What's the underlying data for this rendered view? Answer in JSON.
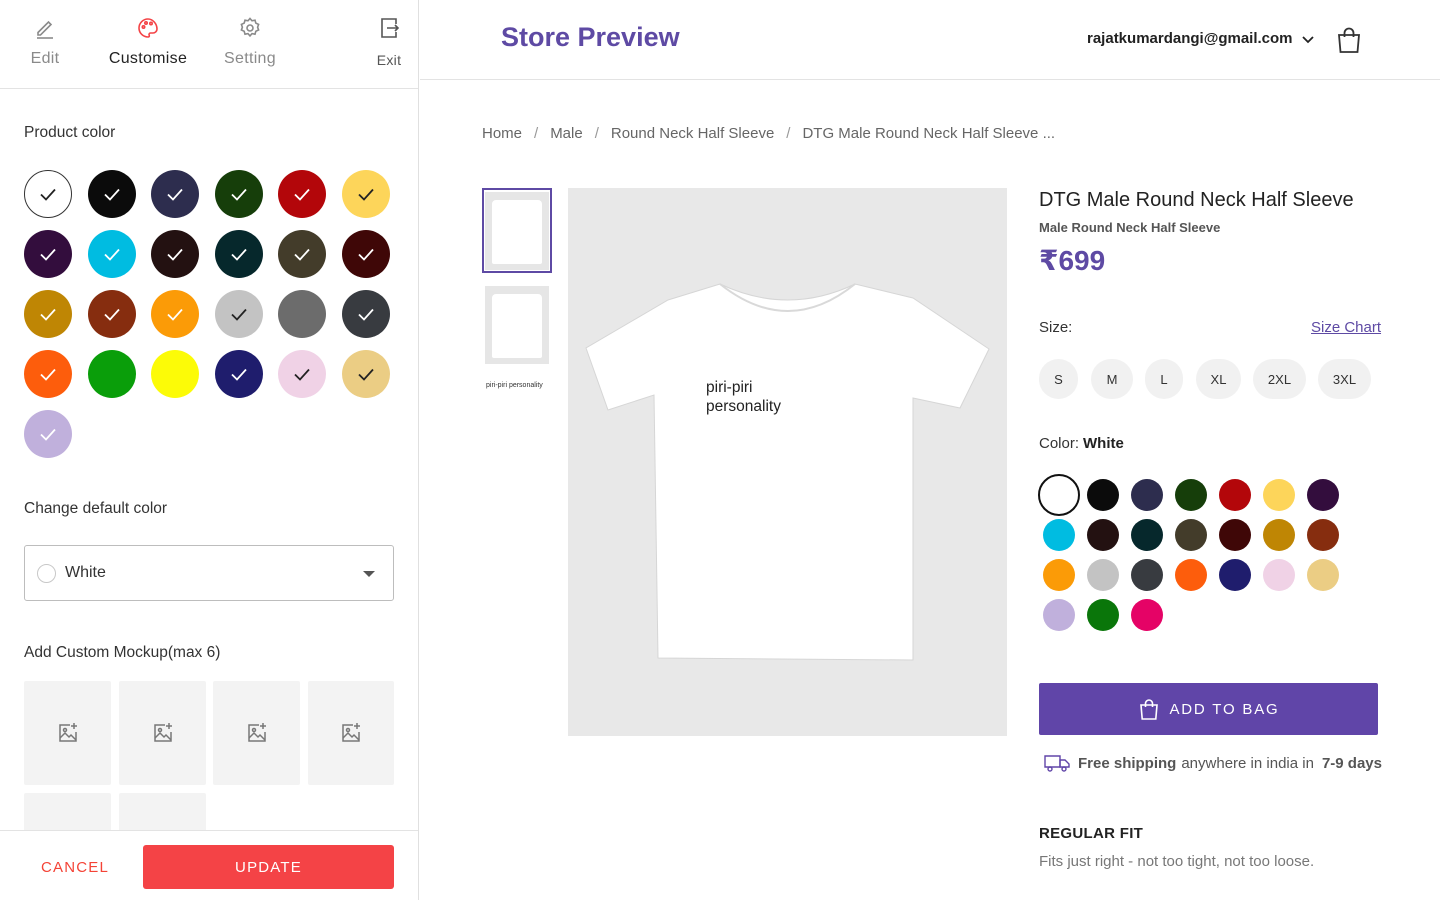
{
  "nav": {
    "edit": "Edit",
    "customise": "Customise",
    "setting": "Setting",
    "exit": "Exit"
  },
  "left": {
    "product_color_title": "Product color",
    "product_colors": [
      {
        "hex": "#ffffff",
        "check": "#222222"
      },
      {
        "hex": "#0b0b0b",
        "check": "#ffffff"
      },
      {
        "hex": "#2d2d4e",
        "check": "#ffffff"
      },
      {
        "hex": "#163e0a",
        "check": "#ffffff"
      },
      {
        "hex": "#b3060a",
        "check": "#ffffff"
      },
      {
        "hex": "#fdd55a",
        "check": "#222222"
      },
      {
        "hex": "#330d3d",
        "check": "#ffffff"
      },
      {
        "hex": "#00bce1",
        "check": "#ffffff"
      },
      {
        "hex": "#231111",
        "check": "#ffffff"
      },
      {
        "hex": "#06282c",
        "check": "#ffffff"
      },
      {
        "hex": "#433c2a",
        "check": "#ffffff"
      },
      {
        "hex": "#3f0707",
        "check": "#ffffff"
      },
      {
        "hex": "#bf8604",
        "check": "#ffffff"
      },
      {
        "hex": "#862d0f",
        "check": "#ffffff"
      },
      {
        "hex": "#fb9b07",
        "check": "#ffffff"
      },
      {
        "hex": "#c3c3c3",
        "check": "#222222"
      },
      {
        "hex": "#6c6c6c",
        "check": null
      },
      {
        "hex": "#383b40",
        "check": "#ffffff"
      },
      {
        "hex": "#fd5d0c",
        "check": "#ffffff"
      },
      {
        "hex": "#0a9e0a",
        "check": null
      },
      {
        "hex": "#fcfb07",
        "check": null
      },
      {
        "hex": "#1f1d6d",
        "check": "#ffffff"
      },
      {
        "hex": "#f0d2e6",
        "check": "#222222"
      },
      {
        "hex": "#ebcd84",
        "check": "#222222"
      },
      {
        "hex": "#c0b0dc",
        "check": "#ffffff"
      }
    ],
    "default_color_title": "Change default color",
    "default_color_value": "White",
    "mockup_title": "Add Custom Mockup(max 6)",
    "cancel": "CANCEL",
    "update": "UPDATE"
  },
  "header": {
    "title": "Store Preview",
    "user_email": "rajatkumardangi@gmail.com"
  },
  "breadcrumb": [
    "Home",
    "Male",
    "Round Neck Half Sleeve",
    "DTG Male Round Neck Half Sleeve ..."
  ],
  "thumb3_text": "piri-piri personality",
  "shirt_print": {
    "line1": "piri-piri",
    "line2": "personality"
  },
  "product": {
    "name": "DTG Male Round Neck Half Sleeve",
    "subtitle": "Male Round Neck Half Sleeve",
    "price": "₹699",
    "size_label": "Size:",
    "size_chart": "Size Chart",
    "sizes": [
      "S",
      "M",
      "L",
      "XL",
      "2XL",
      "3XL"
    ],
    "color_label": "Color:",
    "color_value": "White",
    "colors": [
      "#ffffff",
      "#0b0b0b",
      "#2d2d4e",
      "#163e0a",
      "#b3060a",
      "#fdd55a",
      "#330d3d",
      "#00bce1",
      "#231111",
      "#06282c",
      "#433c2a",
      "#3f0707",
      "#bf8604",
      "#862d0f",
      "#fb9b07",
      "#c3c3c3",
      "#383b40",
      "#fd5d0c",
      "#1f1d6d",
      "#f0d2e6",
      "#ebcd84",
      "#c0b0dc",
      "#0a760a",
      "#e50366"
    ],
    "add_to_bag": "ADD TO BAG",
    "ship_bold": "Free shipping",
    "ship_mid": "anywhere in india in",
    "ship_days": "7-9 days",
    "fit_title": "REGULAR FIT",
    "fit_desc": "Fits just right - not too tight, not too loose."
  },
  "accent": "#5e4aa4",
  "danger": "#f44346"
}
